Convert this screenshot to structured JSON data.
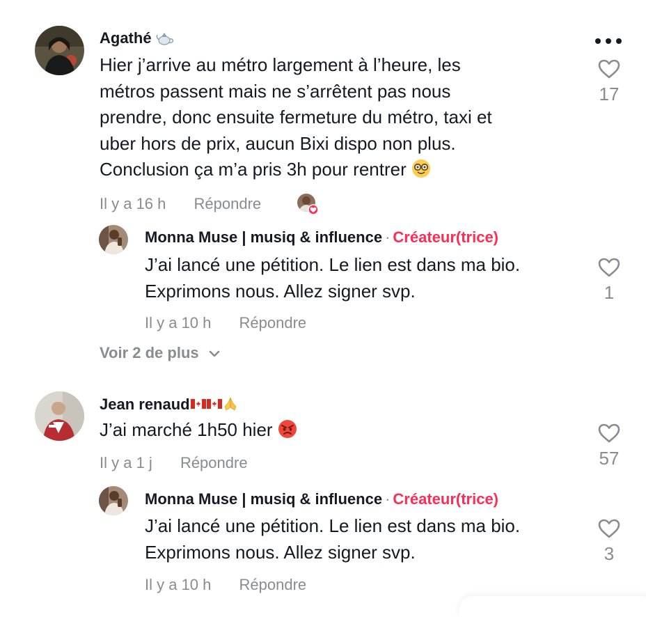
{
  "colors": {
    "text": "#161823",
    "secondary": "#8a8b91",
    "creator": "#fe2c55"
  },
  "comments": [
    {
      "author": "Agathé",
      "author_emoji": "teapot-icon",
      "text_lines": [
        "Hier j’arrive au métro largement à l’heure, les",
        "métros passent mais ne s’arrêtent pas nous",
        "prendre, donc ensuite fermeture du métro, taxi et",
        "uber hors de prix, aucun Bixi dispo non plus.",
        "Conclusion ça m’a pris 3h pour rentrer"
      ],
      "text_emoji": "nerd-face-icon",
      "time": "Il y a 16 h",
      "reply_label": "Répondre",
      "likes": "17",
      "creator_liked": true,
      "replies": [
        {
          "author": "Monna Muse | musiq & influence",
          "separator": "·",
          "badge": "Créateur(trice)",
          "text_lines": [
            "J’ai lancé une pétition. Le lien est dans ma bio.",
            "Exprimons nous. Allez signer svp."
          ],
          "time": "Il y a 10 h",
          "reply_label": "Répondre",
          "likes": "1"
        }
      ],
      "view_more": "Voir 2 de plus"
    },
    {
      "author": "Jean renaud",
      "author_emoji": "canada-flag-icon canada-flag-icon folded-hands-icon",
      "text": "J’ai marché 1h50 hier",
      "text_emoji": "angry-face-icon",
      "time": "Il y a 1 j",
      "reply_label": "Répondre",
      "likes": "57",
      "replies": [
        {
          "author": "Monna Muse | musiq & influence",
          "separator": "·",
          "badge": "Créateur(trice)",
          "text_lines": [
            "J’ai lancé une pétition. Le lien est dans ma bio.",
            "Exprimons nous. Allez signer svp."
          ],
          "time": "Il y a 10 h",
          "reply_label": "Répondre",
          "likes": "3"
        }
      ]
    }
  ]
}
